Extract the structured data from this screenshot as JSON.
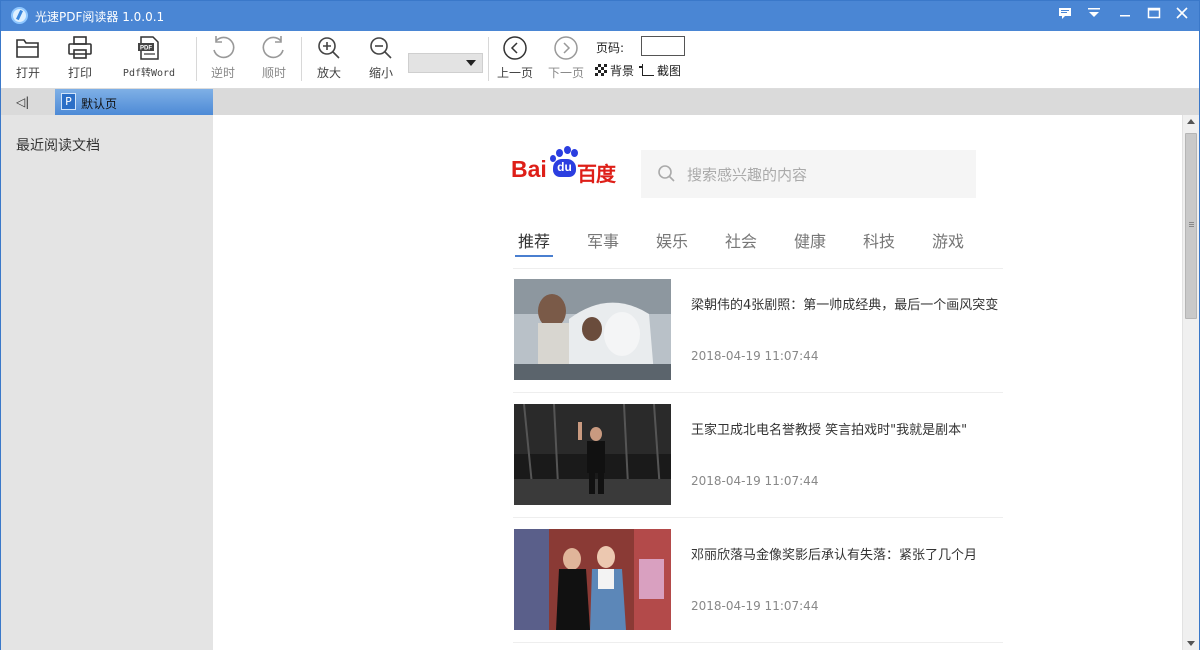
{
  "window": {
    "title": "光速PDF阅读器 1.0.0.1"
  },
  "toolbar": {
    "open": "打开",
    "print": "打印",
    "pdf_to_word": "Pdf转Word",
    "rotate_ccw": "逆时",
    "rotate_cw": "顺时",
    "zoom_in": "放大",
    "zoom_out": "缩小",
    "zoom_value": "",
    "prev_page": "上一页",
    "next_page": "下一页",
    "page_label": "页码:",
    "page_value": "",
    "background": "背景",
    "screenshot": "截图"
  },
  "tabs": {
    "active_tab": "默认页",
    "tab_icon_letter": "P"
  },
  "sidebar": {
    "title": "最近阅读文档"
  },
  "baidu": {
    "logo_bai": "Bai",
    "logo_du": "du",
    "logo_cn": "百度",
    "search_placeholder": "搜索感兴趣的内容",
    "tabs": [
      "推荐",
      "军事",
      "娱乐",
      "社会",
      "健康",
      "科技",
      "游戏"
    ],
    "active_tab_index": 0
  },
  "news": [
    {
      "title": "梁朝伟的4张剧照：第一帅成经典，最后一个画风突变",
      "time": "2018-04-19 11:07:44"
    },
    {
      "title": "王家卫成北电名誉教授 笑言拍戏时\"我就是剧本\"",
      "time": "2018-04-19 11:07:44"
    },
    {
      "title": "邓丽欣落马金像奖影后承认有失落：紧张了几个月",
      "time": "2018-04-19 11:07:44"
    }
  ],
  "colors": {
    "titlebar": "#4a86d4",
    "tab_active": "#5b95d9",
    "baidu_red": "#de1f18",
    "baidu_blue": "#2b3ee0"
  }
}
